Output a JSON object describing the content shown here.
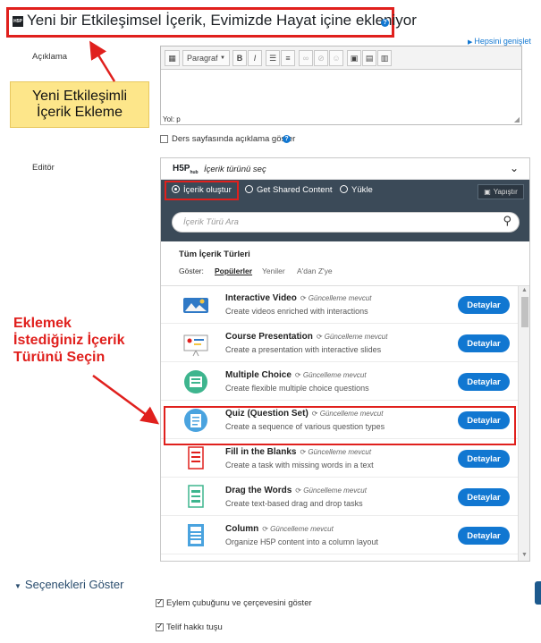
{
  "header": {
    "title": "Yeni bir Etkileşimsel İçerik, Evimizde Hayat içine ekleniyor",
    "h5p_badge": "H5P",
    "expand_all": "Hepsini genişlet"
  },
  "annotations": {
    "add_label": "Yeni Etkileşimli İçerik Ekleme",
    "choose_label": "Eklemek İstediğiniz İçerik Türünü Seçin"
  },
  "form": {
    "description_label": "Açıklama",
    "editor_label": "Editör",
    "paragraph_select": "Paragraf",
    "path_text": "Yol: p",
    "show_on_course_label": "Ders sayfasında açıklama göster"
  },
  "hub": {
    "logo": "H5P",
    "logo_hub": "hub",
    "title": "İçerik türünü seç",
    "tabs": [
      "İçerik oluştur",
      "Get Shared Content",
      "Yükle"
    ],
    "paste_label": "Yapıştır",
    "search_placeholder": "İçerik Türü Ara",
    "all_types_title": "Tüm İçerik Türleri",
    "show_label": "Göster:",
    "filters": [
      "Popülerler",
      "Yeniler",
      "A'dan Z'ye"
    ],
    "update_text": "Güncelleme mevcut",
    "details_label": "Detaylar",
    "content_types": [
      {
        "name": "Interactive Video",
        "desc": "Create videos enriched with interactions"
      },
      {
        "name": "Course Presentation",
        "desc": "Create a presentation with interactive slides"
      },
      {
        "name": "Multiple Choice",
        "desc": "Create flexible multiple choice questions"
      },
      {
        "name": "Quiz (Question Set)",
        "desc": "Create a sequence of various question types"
      },
      {
        "name": "Fill in the Blanks",
        "desc": "Create a task with missing words in a text"
      },
      {
        "name": "Drag the Words",
        "desc": "Create text-based drag and drop tasks"
      },
      {
        "name": "Column",
        "desc": "Organize H5P content into a column layout"
      }
    ]
  },
  "options": {
    "section_title": "Seçenekleri Göster",
    "items": [
      "Eylem çubuğunu ve çerçevesini göster",
      "Telif hakkı tuşu"
    ]
  },
  "colors": {
    "accent_red": "#e0201d",
    "link_blue": "#1177d1",
    "hub_dark": "#3b4a58",
    "note_yellow": "#fde68a"
  }
}
